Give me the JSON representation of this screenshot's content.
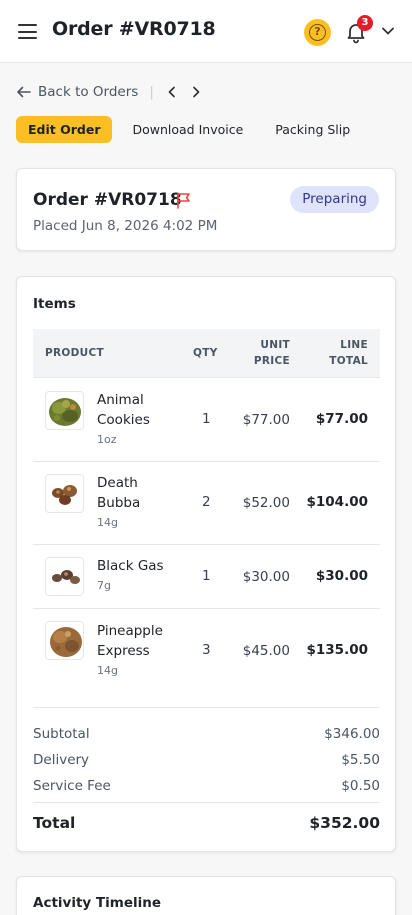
{
  "header": {
    "title": "Order #VR0718",
    "help_glyph": "?",
    "notification_count": "3",
    "icons": [
      "menu-icon",
      "help-icon",
      "bell-icon",
      "chevron-down-icon"
    ]
  },
  "subnav": {
    "back_label": "Back to Orders",
    "separator": "|"
  },
  "actions": {
    "edit": "Edit Order",
    "invoice": "Download Invoice",
    "slip": "Packing Slip"
  },
  "order": {
    "title": "Order #VR0718",
    "placed": "Placed Jun 8, 2026 4:02 PM",
    "status": "Preparing"
  },
  "items": {
    "title": "Items",
    "columns": {
      "product": "PRODUCT",
      "qty": "QTY",
      "unit_price_1": "UNIT",
      "unit_price_2": "PRICE",
      "line_total_1": "LINE",
      "line_total_2": "TOTAL"
    },
    "rows": [
      {
        "name_1": "Animal",
        "name_2": "Cookies",
        "size": "1oz",
        "qty": "1",
        "unit": "$77.00",
        "total": "$77.00"
      },
      {
        "name_1": "Death",
        "name_2": "Bubba",
        "size": "14g",
        "qty": "2",
        "unit": "$52.00",
        "total": "$104.00"
      },
      {
        "name_1": "Black Gas",
        "size": "7g",
        "qty": "1",
        "unit": "$30.00",
        "total": "$30.00"
      },
      {
        "name_1": "Pineapple",
        "name_2": "Express",
        "size": "14g",
        "qty": "3",
        "unit": "$45.00",
        "total": "$135.00"
      }
    ],
    "subtotal_label": "Subtotal",
    "subtotal": "$346.00",
    "delivery_label": "Delivery",
    "delivery": "$5.50",
    "fee_label": "Service Fee",
    "fee": "$0.50",
    "total_label": "Total",
    "total": "$352.00"
  },
  "activity": {
    "title": "Activity Timeline"
  },
  "colors": {
    "accent": "#fbbf24",
    "badge": "#e11d2a",
    "status_bg": "#e0e4fb",
    "status_text": "#2f3a8f",
    "flag": "#ef4444"
  }
}
